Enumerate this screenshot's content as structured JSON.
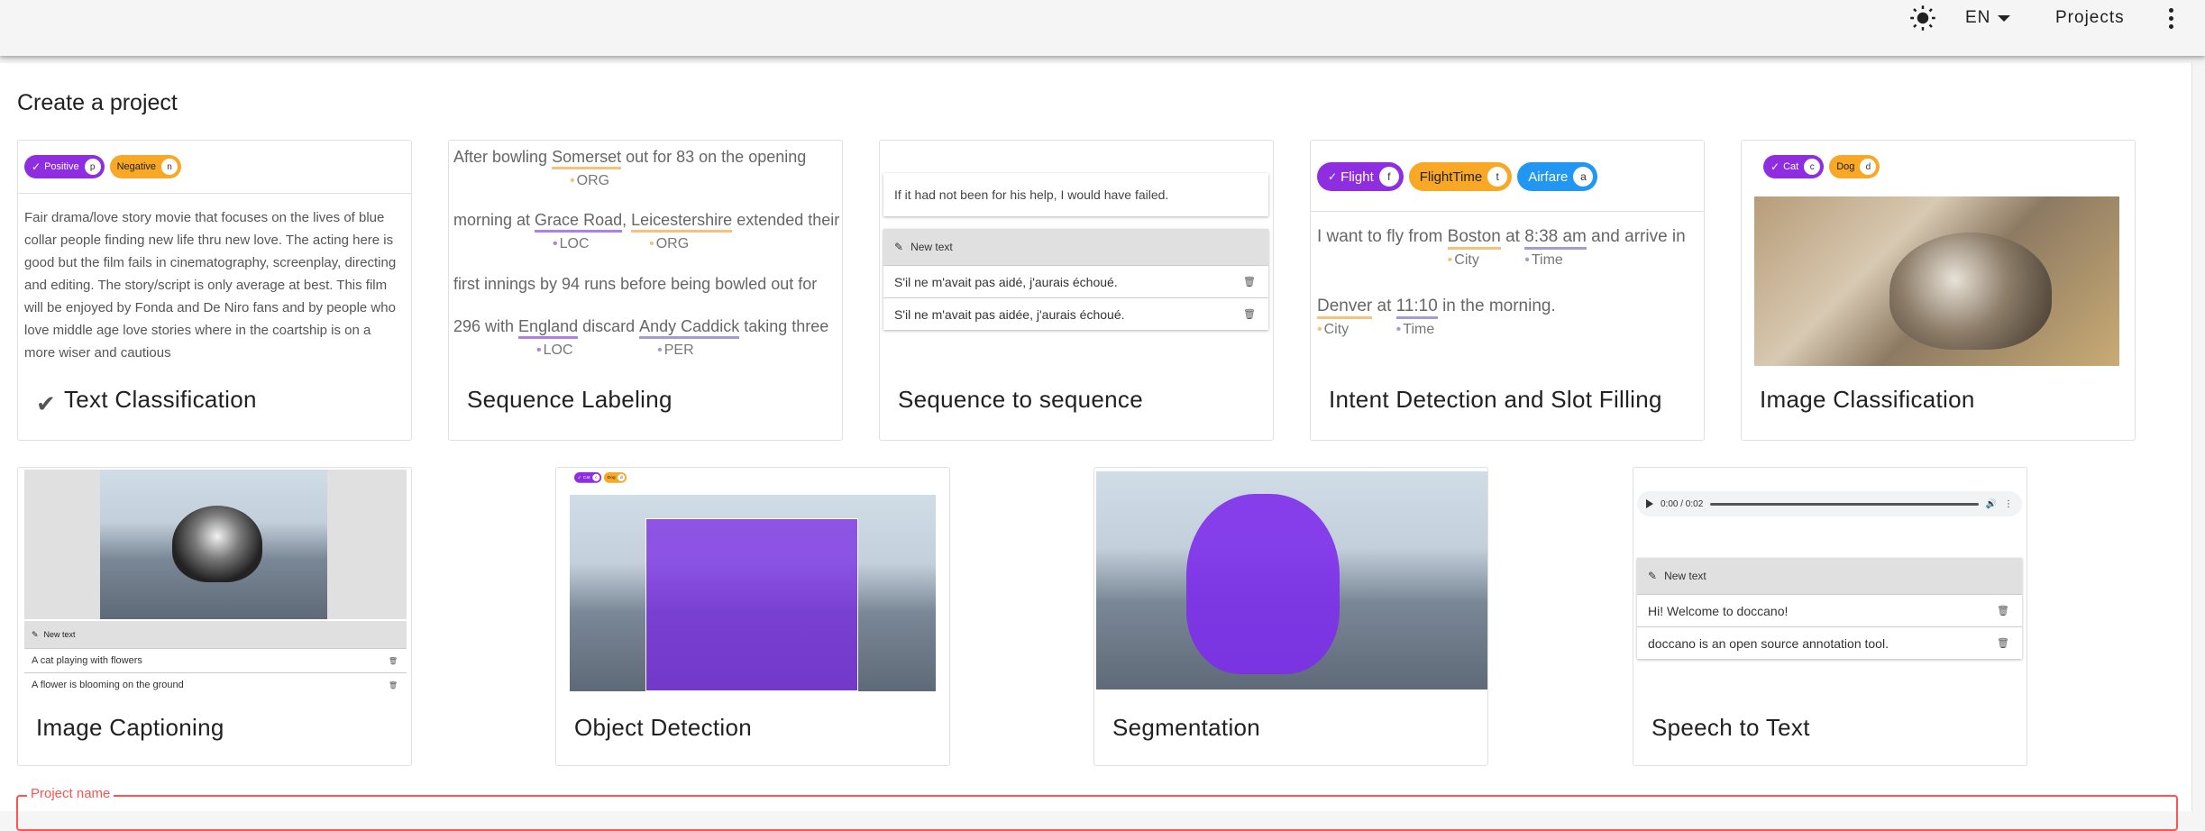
{
  "appbar": {
    "lang": "EN",
    "projects": "Projects"
  },
  "page": {
    "title": "Create a project"
  },
  "cards": {
    "text_classification": {
      "title": "Text Classification",
      "chips": [
        {
          "label": "Positive",
          "key": "p"
        },
        {
          "label": "Negative",
          "key": "n"
        }
      ],
      "text": "Fair drama/love story movie that focuses on the lives of blue collar people finding new life thru new love. The acting here is good but the film fails in cinematography, screenplay, directing and editing. The story/script is only average at best. This film will be enjoyed by Fonda and De Niro fans and by people who love middle age love stories where in the coartship is on a more wiser and cautious"
    },
    "sequence_labeling": {
      "title": "Sequence Labeling",
      "lines": {
        "l1_a": "After bowling ",
        "l1_ent": "Somerset",
        "l1_lab": "ORG",
        "l1_b": " out for 83 on the opening",
        "l2_a": "morning at ",
        "l2_ent1": "Grace Road",
        "l2_lab1": "LOC",
        "l2_b": ", ",
        "l2_ent2": "Leicestershire",
        "l2_lab2": "ORG",
        "l2_c": " extended their",
        "l3": "first innings by 94 runs before being bowled out for",
        "l4_a": "296 with ",
        "l4_ent1": "England",
        "l4_lab1": "LOC",
        "l4_b": " discard ",
        "l4_ent2": "Andy Caddick",
        "l4_lab2": "PER",
        "l4_c": " taking three"
      }
    },
    "seq2seq": {
      "title": "Sequence to sequence",
      "source": "If it had not been for his help, I would have failed.",
      "new_text": "New text",
      "rows": [
        "S'il ne m'avait pas aidé, j'aurais échoué.",
        "S'il ne m'avait pas aidée, j'aurais échoué."
      ]
    },
    "intent": {
      "title": "Intent Detection and Slot Filling",
      "chips": [
        {
          "label": "Flight",
          "key": "f"
        },
        {
          "label": "FlightTime",
          "key": "t"
        },
        {
          "label": "Airfare",
          "key": "a"
        }
      ],
      "l1_a": "I want to fly from ",
      "l1_ent1": "Boston",
      "l1_lab1": "City",
      "l1_b": " at ",
      "l1_ent2": "8:38 am",
      "l1_lab2": "Time",
      "l1_c": " and arrive in",
      "l2_ent1": "Denver",
      "l2_lab1": "City",
      "l2_b": " at ",
      "l2_ent2": "11:10",
      "l2_lab2": "Time",
      "l2_c": " in the morning."
    },
    "image_classification": {
      "title": "Image Classification",
      "chips": [
        {
          "label": "Cat",
          "key": "c"
        },
        {
          "label": "Dog",
          "key": "d"
        }
      ]
    },
    "image_captioning": {
      "title": "Image Captioning",
      "new_text": "New text",
      "rows": [
        "A cat playing with flowers",
        "A flower is blooming on the ground"
      ]
    },
    "object_detection": {
      "title": "Object Detection",
      "chips": [
        {
          "label": "Cat",
          "key": "c"
        },
        {
          "label": "Dog",
          "key": "d"
        }
      ]
    },
    "segmentation": {
      "title": "Segmentation"
    },
    "speech_to_text": {
      "title": "Speech to Text",
      "audio_time": "0:00 / 0:02",
      "new_text": "New text",
      "rows": [
        "Hi! Welcome to doccano!",
        "doccano is an open source annotation tool."
      ]
    }
  },
  "form": {
    "project_name_label": "Project name"
  },
  "colors": {
    "purple": "#8e2ee0",
    "orange": "#f9a825",
    "blue": "#2196f3",
    "error": "#ff5252"
  }
}
